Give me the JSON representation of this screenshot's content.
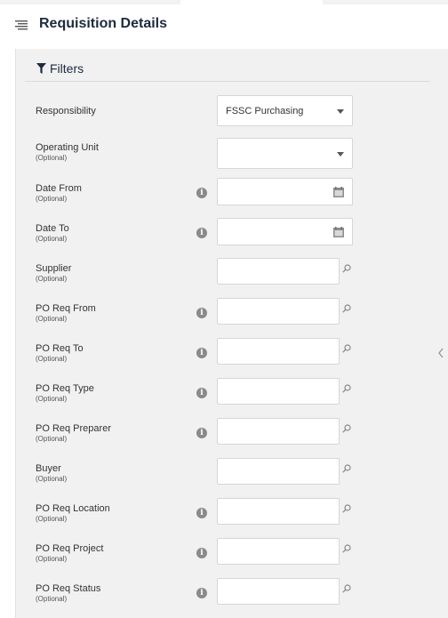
{
  "header": {
    "title": "Requisition Details",
    "menu_icon": "hamburger-list-icon"
  },
  "filters": {
    "title": "Filters",
    "icon": "funnel-icon",
    "optional_label": "(Optional)",
    "responsibility": {
      "label": "Responsibility",
      "value": "FSSC Purchasing"
    },
    "operating_unit": {
      "label": "Operating Unit",
      "value": ""
    },
    "date_from": {
      "label": "Date From",
      "value": ""
    },
    "date_to": {
      "label": "Date To",
      "value": ""
    },
    "supplier": {
      "label": "Supplier",
      "value": ""
    },
    "po_req_from": {
      "label": "PO Req From",
      "value": ""
    },
    "po_req_to": {
      "label": "PO Req To",
      "value": ""
    },
    "po_req_type": {
      "label": "PO Req Type",
      "value": ""
    },
    "po_req_preparer": {
      "label": "PO Req Preparer",
      "value": ""
    },
    "buyer": {
      "label": "Buyer",
      "value": ""
    },
    "po_req_location": {
      "label": "PO Req Location",
      "value": ""
    },
    "po_req_project": {
      "label": "PO Req Project",
      "value": ""
    },
    "po_req_status": {
      "label": "PO Req Status",
      "value": ""
    }
  },
  "colors": {
    "title": "#1c2b3f",
    "panel_bg": "#f1f1f1",
    "info_icon": "#8a8a8a"
  }
}
